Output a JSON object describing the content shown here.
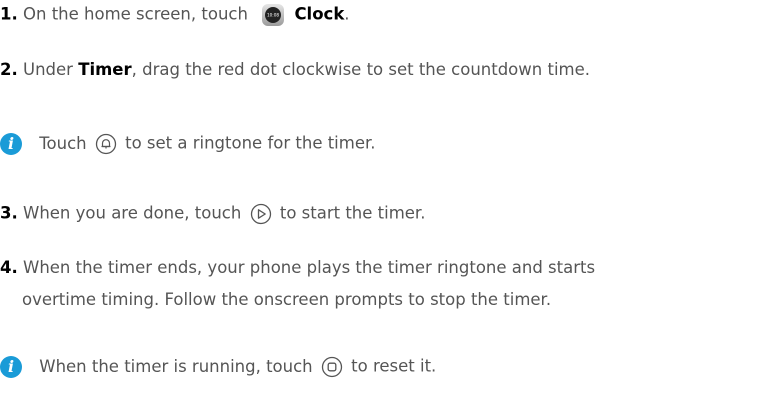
{
  "steps": [
    {
      "number": "1.",
      "text_before": "On the home screen, touch",
      "app_icon": "clock-app-icon",
      "app_icon_time": "10:08",
      "app_name": "Clock",
      "text_after": "."
    },
    {
      "number": "2.",
      "text_before": "Under",
      "bold": "Timer",
      "text_after": ", drag the red dot clockwise to set the countdown time."
    },
    {
      "number": "3.",
      "text_before": "When you are done, touch",
      "icon": "play-circle-icon",
      "text_after": "to start the timer."
    },
    {
      "number": "4.",
      "line1": "When the timer ends, your phone plays the timer ringtone and starts",
      "line2": "overtime timing. Follow the onscreen prompts to stop the timer."
    }
  ],
  "notes": [
    {
      "icon": "info-icon",
      "info_glyph": "i",
      "text_before": "Touch",
      "inline_icon": "bell-circle-icon",
      "text_after": "to set a ringtone for the timer."
    },
    {
      "icon": "info-icon",
      "info_glyph": "i",
      "text_before": "When the timer is running, touch",
      "inline_icon": "stop-circle-icon",
      "text_after": "to reset it."
    }
  ],
  "colors": {
    "info_blue": "#1a9bd7",
    "body_text": "#555555",
    "step_number": "#000000"
  }
}
